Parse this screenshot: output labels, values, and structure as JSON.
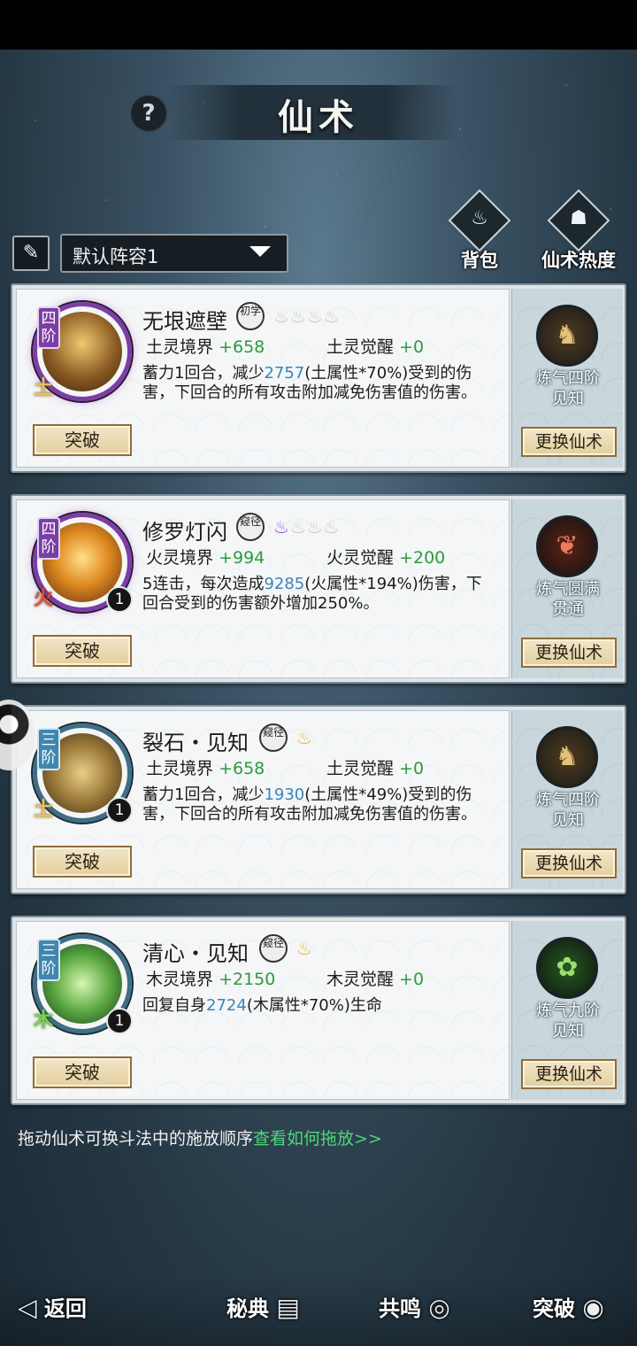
{
  "header": {
    "title": "仙术",
    "help": "?"
  },
  "toolbar": {
    "lineup": "默认阵容1"
  },
  "top_buttons": [
    {
      "label": "背包",
      "icon": "bag-icon"
    },
    {
      "label": "仙术热度",
      "icon": "book-flame-icon"
    }
  ],
  "skills": [
    {
      "tier": "四阶",
      "element": "土",
      "count": "",
      "name": "无垠遮壁",
      "stamp": "初学",
      "stat1_label": "土灵境界",
      "stat1_value": "+658",
      "stat2_label": "土灵觉醒",
      "stat2_value": "+0",
      "desc_pre": "蓄力1回合，减少",
      "desc_num": "2757",
      "desc_post": "(土属性*70%)受到的伤害，下回合的所有攻击附加减免伤害值的伤害。",
      "break_label": "突破",
      "realm_line1": "炼气四阶",
      "realm_line2": "见知",
      "change_label": "更换仙术"
    },
    {
      "tier": "四阶",
      "element": "火",
      "count": "1",
      "name": "修罗灯闪",
      "stamp": "窥径",
      "stat1_label": "火灵境界",
      "stat1_value": "+994",
      "stat2_label": "火灵觉醒",
      "stat2_value": "+200",
      "desc_pre": "5连击，每次造成",
      "desc_num": "9285",
      "desc_post": "(火属性*194%)伤害，下回合受到的伤害额外增加250%。",
      "break_label": "突破",
      "realm_line1": "炼气圆满",
      "realm_line2": "贯通",
      "change_label": "更换仙术"
    },
    {
      "tier": "三阶",
      "element": "土",
      "count": "1",
      "name": "裂石・见知",
      "stamp": "窥径",
      "stat1_label": "土灵境界",
      "stat1_value": "+658",
      "stat2_label": "土灵觉醒",
      "stat2_value": "+0",
      "desc_pre": "蓄力1回合，减少",
      "desc_num": "1930",
      "desc_post": "(土属性*49%)受到的伤害，下回合的所有攻击附加减免伤害值的伤害。",
      "break_label": "突破",
      "realm_line1": "炼气四阶",
      "realm_line2": "见知",
      "change_label": "更换仙术"
    },
    {
      "tier": "三阶",
      "element": "木",
      "count": "1",
      "name": "清心・见知",
      "stamp": "窥径",
      "stat1_label": "木灵境界",
      "stat1_value": "+2150",
      "stat2_label": "木灵觉醒",
      "stat2_value": "+0",
      "desc_pre": "回复自身",
      "desc_num": "2724",
      "desc_post": "(木属性*70%)生命",
      "break_label": "突破",
      "realm_line1": "炼气九阶",
      "realm_line2": "见知",
      "change_label": "更换仙术"
    }
  ],
  "hint": {
    "text": "拖动仙术可换斗法中的施放顺序",
    "link": "查看如何拖放>>"
  },
  "nav": [
    {
      "label": "返回",
      "icon": "back-arrow-icon"
    },
    {
      "label": "秘典",
      "icon": "open-book-icon"
    },
    {
      "label": "共鸣",
      "icon": "swirl-icon"
    },
    {
      "label": "突破",
      "icon": "vortex-icon"
    }
  ],
  "colors": {
    "accent_green": "#2e9a3f",
    "number_blue": "#3c84b8",
    "link_green": "#4fd67a",
    "button_gold": "#e3cf9d"
  }
}
